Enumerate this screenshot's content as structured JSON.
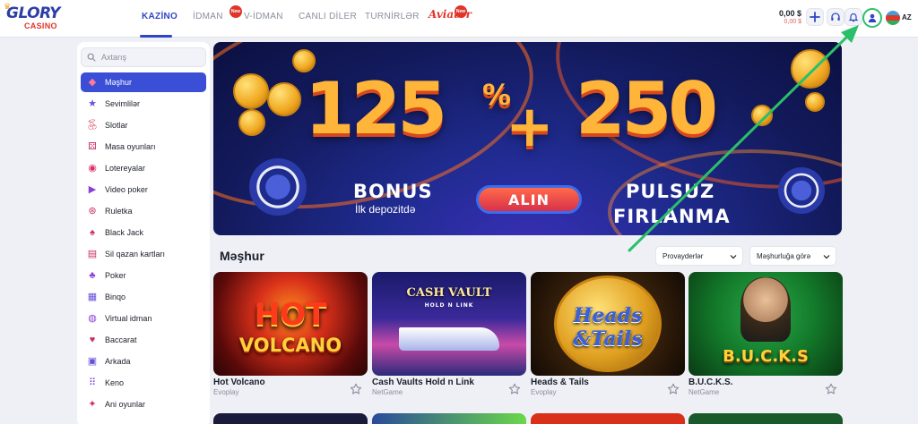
{
  "header": {
    "logo_main": "GLORY",
    "logo_sub": "CASINO",
    "nav": [
      {
        "label": "KAZİNO",
        "active": true
      },
      {
        "label": "İDMAN",
        "badge": "New"
      },
      {
        "label": "V-İDMAN"
      },
      {
        "label": "CANLI DİLER"
      },
      {
        "label": "TURNİRLƏR"
      },
      {
        "label": "Aviator",
        "badge": "New"
      }
    ],
    "balance": "0,00 $",
    "bonus_balance": "0,00 $",
    "language": "AZ"
  },
  "sidebar": {
    "search_placeholder": "Axtarış",
    "items": [
      {
        "label": "Məşhur",
        "icon": "diamond-icon",
        "active": true
      },
      {
        "label": "Sevimlilər",
        "icon": "star-icon"
      },
      {
        "label": "Slotlar",
        "icon": "cherry-icon"
      },
      {
        "label": "Masa oyunları",
        "icon": "dice-icon"
      },
      {
        "label": "Lotereyalar",
        "icon": "lottery-ball-icon"
      },
      {
        "label": "Video poker",
        "icon": "video-poker-icon"
      },
      {
        "label": "Ruletka",
        "icon": "roulette-icon"
      },
      {
        "label": "Black Jack",
        "icon": "blackjack-icon"
      },
      {
        "label": "Sil qazan kartları",
        "icon": "scratch-card-icon"
      },
      {
        "label": "Poker",
        "icon": "poker-icon"
      },
      {
        "label": "Binqo",
        "icon": "bingo-icon"
      },
      {
        "label": "Virtual idman",
        "icon": "gamepad-icon"
      },
      {
        "label": "Baccarat",
        "icon": "cards-icon"
      },
      {
        "label": "Arkada",
        "icon": "arcade-icon"
      },
      {
        "label": "Keno",
        "icon": "keno-icon"
      },
      {
        "label": "Ani oyunlar",
        "icon": "instant-game-icon"
      }
    ]
  },
  "banner": {
    "percent_value": "125",
    "percent_sign": "%",
    "plus": "+",
    "spins_value": "250",
    "bonus_title": "BONUS",
    "bonus_sub": "İlk depozitdə",
    "cta": "ALIN",
    "spins_title_1": "PULSUZ",
    "spins_title_2": "FIRLANMA"
  },
  "section": {
    "title": "Məşhur",
    "provider_filter": "Provayderlər",
    "sort_filter": "Məşhurluğa görə"
  },
  "games": [
    {
      "name": "Hot Volcano",
      "provider": "Evoplay",
      "thumb_text_1": "HOT",
      "thumb_text_2": "VOLCANO"
    },
    {
      "name": "Cash Vaults Hold n Link",
      "provider": "NetGame",
      "thumb_text_1": "CASH VAULT",
      "thumb_text_2": "HOLD N LINK"
    },
    {
      "name": "Heads & Tails",
      "provider": "Evoplay",
      "thumb_text_1": "Heads",
      "thumb_text_2": "&Tails"
    },
    {
      "name": "B.U.C.K.S.",
      "provider": "NetGame",
      "thumb_text_1": "B.U.C.K.S"
    }
  ],
  "colors": {
    "accent": "#2e45c8",
    "active_sidebar": "#3b4fd6",
    "brand_red": "#e0352b",
    "highlight_green": "#2cbf6a",
    "banner_bg": "#131a5c"
  }
}
